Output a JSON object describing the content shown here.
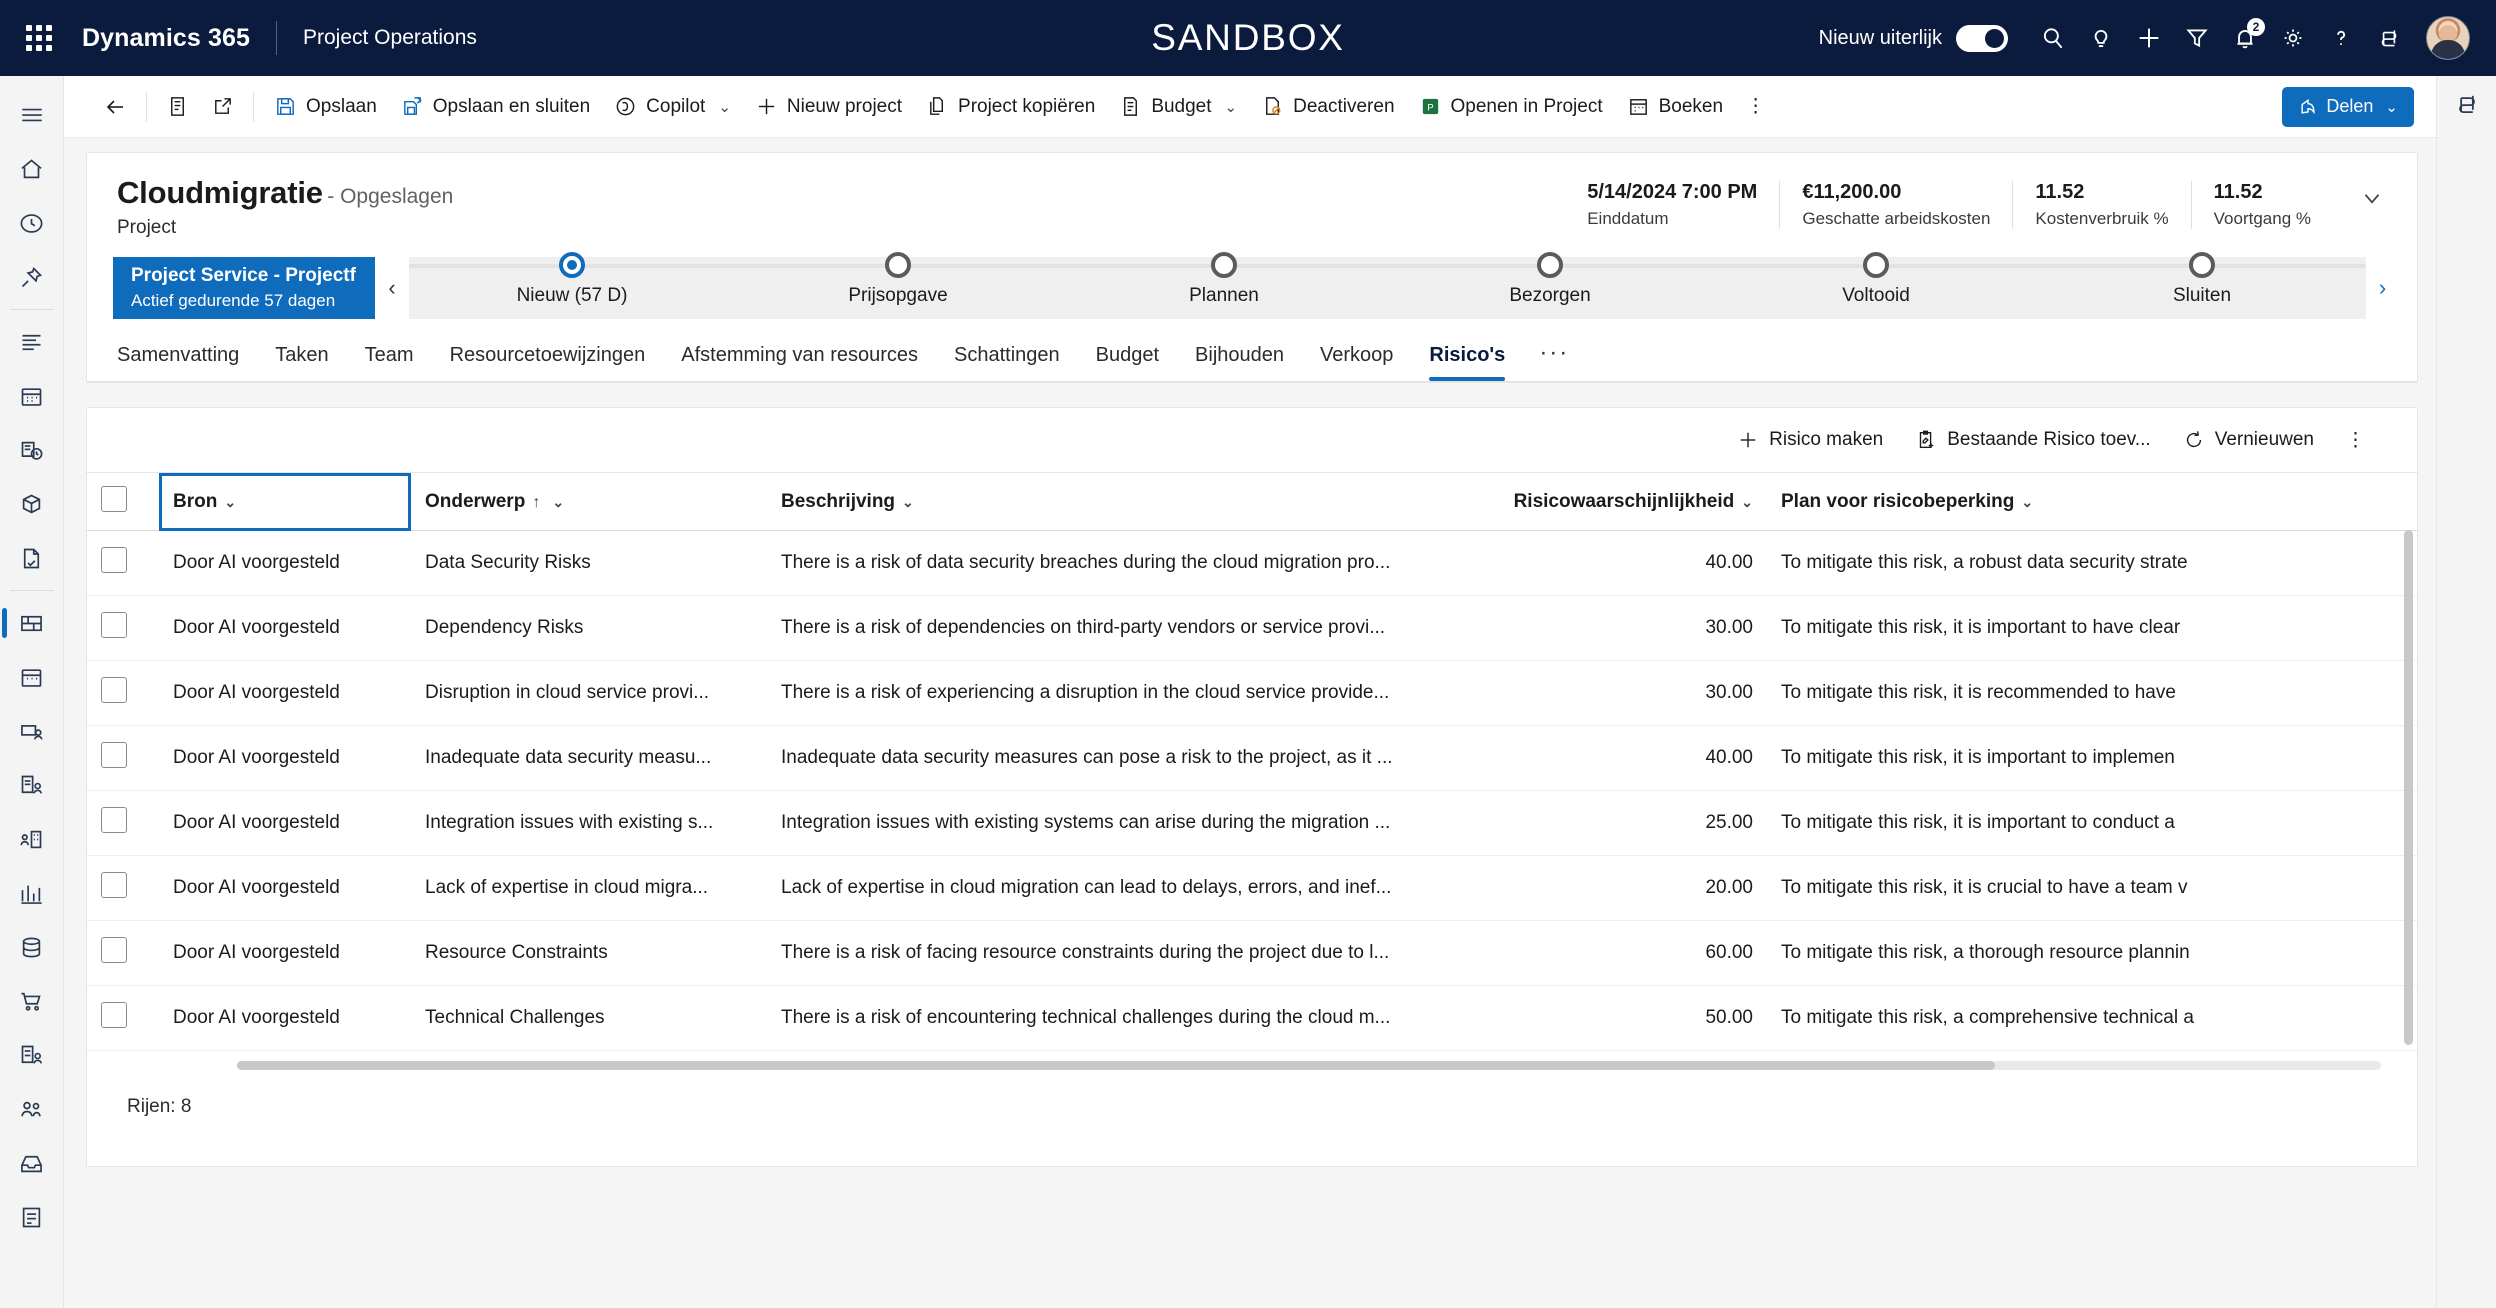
{
  "topnav": {
    "brand": "Dynamics 365",
    "app_name": "Project Operations",
    "environment_banner": "SANDBOX",
    "new_look_label": "Nieuw uiterlijk",
    "notification_count": "2",
    "icons": [
      "search-icon",
      "lightbulb-icon",
      "plus-icon",
      "filter-icon",
      "bell-icon",
      "gear-icon",
      "help-icon",
      "copilot-icon"
    ]
  },
  "commandbar": {
    "back": "",
    "save": "Opslaan",
    "save_and_close": "Opslaan en sluiten",
    "copilot": "Copilot",
    "new_project": "Nieuw project",
    "copy_project": "Project kopiëren",
    "budget": "Budget",
    "deactivate": "Deactiveren",
    "open_in_project": "Openen in Project",
    "book": "Boeken",
    "overflow": "⋮",
    "share": "Delen"
  },
  "record": {
    "title": "Cloudmigratie",
    "saved_state": "- Opgeslagen",
    "entity": "Project",
    "stats": [
      {
        "value": "5/14/2024 7:00 PM",
        "label": "Einddatum"
      },
      {
        "value": "€11,200.00",
        "label": "Geschatte arbeidskosten"
      },
      {
        "value": "11.52",
        "label": "Kostenverbruik %"
      },
      {
        "value": "11.52",
        "label": "Voortgang %"
      }
    ]
  },
  "bpf": {
    "name": "Project Service - Projectf...",
    "status": "Actief gedurende 57 dagen",
    "stages": [
      {
        "label": "Nieuw  (57 D)",
        "active": true
      },
      {
        "label": "Prijsopgave",
        "active": false
      },
      {
        "label": "Plannen",
        "active": false
      },
      {
        "label": "Bezorgen",
        "active": false
      },
      {
        "label": "Voltooid",
        "active": false
      },
      {
        "label": "Sluiten",
        "active": false
      }
    ]
  },
  "tabs": {
    "items": [
      "Samenvatting",
      "Taken",
      "Team",
      "Resourcetoewijzingen",
      "Afstemming van resources",
      "Schattingen",
      "Budget",
      "Bijhouden",
      "Verkoop",
      "Risico's"
    ],
    "active": "Risico's",
    "overflow": "···"
  },
  "grid_toolbar": {
    "create_risk": "Risico maken",
    "add_existing_risk": "Bestaande Risico toev...",
    "refresh": "Vernieuwen",
    "overflow": "⋮"
  },
  "grid": {
    "columns": [
      {
        "key": "bron",
        "label": "Bron",
        "focused": true,
        "sorted": false
      },
      {
        "key": "onderwerp",
        "label": "Onderwerp",
        "focused": false,
        "sorted": true,
        "sort_dir": "↑"
      },
      {
        "key": "beschrijving",
        "label": "Beschrijving",
        "focused": false,
        "sorted": false
      },
      {
        "key": "waarschijnlijkheid",
        "label": "Risicowaarschijnlijkheid",
        "focused": false,
        "sorted": false,
        "numeric": true
      },
      {
        "key": "plan",
        "label": "Plan voor risicobeperking",
        "focused": false,
        "sorted": false
      }
    ],
    "rows": [
      {
        "bron": "Door AI voorgesteld",
        "onderwerp": "Data Security Risks",
        "beschrijving": "There is a risk of data security breaches during the cloud migration pro...",
        "waarschijnlijkheid": "40.00",
        "plan": "To mitigate this risk, a robust data security strate"
      },
      {
        "bron": "Door AI voorgesteld",
        "onderwerp": "Dependency Risks",
        "beschrijving": "There is a risk of dependencies on third-party vendors or service provi...",
        "waarschijnlijkheid": "30.00",
        "plan": "To mitigate this risk, it is important to have clear"
      },
      {
        "bron": "Door AI voorgesteld",
        "onderwerp": "Disruption in cloud service provi...",
        "beschrijving": "There is a risk of experiencing a disruption in the cloud service provide...",
        "waarschijnlijkheid": "30.00",
        "plan": "To mitigate this risk, it is recommended to have"
      },
      {
        "bron": "Door AI voorgesteld",
        "onderwerp": "Inadequate data security measu...",
        "beschrijving": "Inadequate data security measures can pose a risk to the project, as it ...",
        "waarschijnlijkheid": "40.00",
        "plan": "To mitigate this risk, it is important to implemen"
      },
      {
        "bron": "Door AI voorgesteld",
        "onderwerp": "Integration issues with existing s...",
        "beschrijving": "Integration issues with existing systems can arise during the migration ...",
        "waarschijnlijkheid": "25.00",
        "plan": "To mitigate this risk, it is important to conduct a"
      },
      {
        "bron": "Door AI voorgesteld",
        "onderwerp": "Lack of expertise in cloud migra...",
        "beschrijving": "Lack of expertise in cloud migration can lead to delays, errors, and inef...",
        "waarschijnlijkheid": "20.00",
        "plan": "To mitigate this risk, it is crucial to have a team v"
      },
      {
        "bron": "Door AI voorgesteld",
        "onderwerp": "Resource Constraints",
        "beschrijving": "There is a risk of facing resource constraints during the project due to l...",
        "waarschijnlijkheid": "60.00",
        "plan": "To mitigate this risk, a thorough resource plannin"
      },
      {
        "bron": "Door AI voorgesteld",
        "onderwerp": "Technical Challenges",
        "beschrijving": "There is a risk of encountering technical challenges during the cloud m...",
        "waarschijnlijkheid": "50.00",
        "plan": "To mitigate this risk, a comprehensive technical a"
      }
    ],
    "row_count_label": "Rijen: 8"
  },
  "sidebar": {
    "items": [
      "hamburger-icon",
      "home-icon",
      "recent-icon",
      "pin-icon",
      "dashboard-icon",
      "calendar-icon",
      "timeentry-icon",
      "package-icon",
      "document-icon",
      "projects-icon",
      "schedule-icon",
      "resource-icon",
      "approvals-icon",
      "account-icon",
      "opportunity-icon",
      "database-icon",
      "cart-icon",
      "invoice-icon",
      "team-icon",
      "inbox-icon",
      "form-icon"
    ]
  },
  "colors": {
    "nav_bg": "#0b1b3d",
    "accent": "#0f6cbd",
    "page_bg": "#f5f5f5",
    "card_bg": "#ffffff"
  }
}
